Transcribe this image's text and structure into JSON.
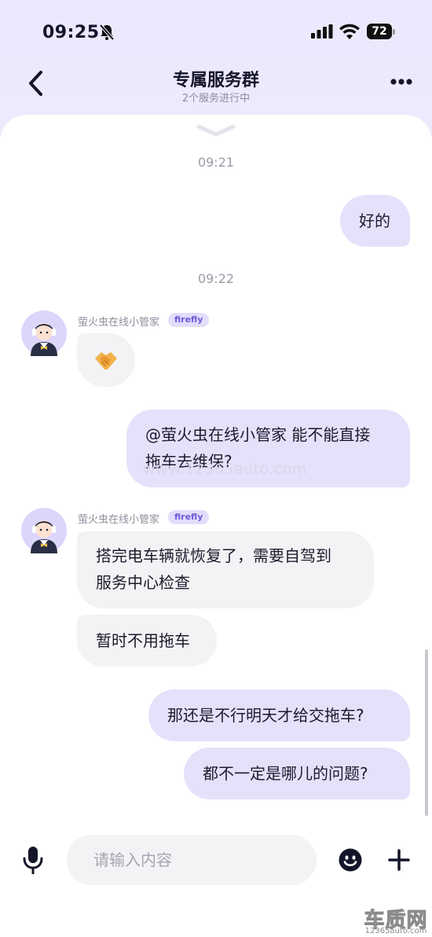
{
  "status_bar": {
    "time": "09:25",
    "battery": "72"
  },
  "header": {
    "title": "专属服务群",
    "subtitle": "2个服务进行中"
  },
  "timestamps": [
    "09:21",
    "09:22"
  ],
  "messages": [
    {
      "side": "out",
      "text": "好的"
    },
    {
      "side": "in",
      "sender": "萤火虫在线小管家",
      "tag": "firefly",
      "sticker": "handshake-sticker"
    },
    {
      "side": "out",
      "lines": [
        "@萤火虫在线小管家 能不能直接",
        "拖车去维保?"
      ]
    },
    {
      "side": "in",
      "sender": "萤火虫在线小管家",
      "tag": "firefly",
      "lines": [
        "搭完电车辆就恢复了，需要自驾到",
        "服务中心检查"
      ]
    },
    {
      "side": "in",
      "text": "暂时不用拖车"
    },
    {
      "side": "out",
      "text": "那还是不行明天才给交拖车?"
    },
    {
      "side": "out",
      "text": "都不一定是哪儿的问题?"
    }
  ],
  "watermark": "www.12365auto.com",
  "input_bar": {
    "placeholder": "请输入内容"
  },
  "logo": {
    "name": "车质网",
    "url": "12365auto.com"
  },
  "colors": {
    "accent": "#6f5ad8",
    "outgoing_bubble": "#e6e1fb",
    "incoming_bubble": "#f3f3f6",
    "header_bg": "#ebe7fd"
  },
  "icons": [
    "bell-muted-icon",
    "signal-icon",
    "wifi-icon",
    "back-icon",
    "more-icon",
    "chevron-down-icon",
    "microphone-icon",
    "emoji-icon",
    "plus-icon"
  ]
}
